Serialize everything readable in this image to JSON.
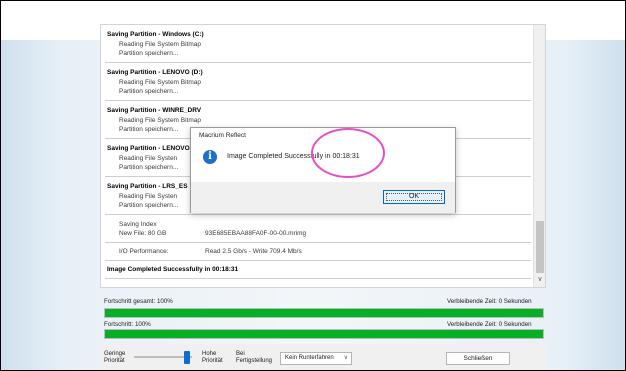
{
  "log": {
    "entries": [
      {
        "title": "Saving Partition - Windows (C:)",
        "lines": [
          "Reading File System Bitmap",
          "Partition speichern..."
        ]
      },
      {
        "title": "Saving Partition - LENOVO (D:)",
        "lines": [
          "Reading File System Bitmap",
          "Partition speichern..."
        ]
      },
      {
        "title": "Saving Partition - WINRE_DRV",
        "lines": [
          "Reading File System Bitmap",
          "Partition speichern..."
        ]
      },
      {
        "title": "Saving Partition - LENOVO",
        "lines": [
          "Reading File Systen",
          "Partition speichern..."
        ]
      },
      {
        "title": "Saving Partition - LRS_ES",
        "lines": [
          "Reading File Systen",
          "Partition speichern..."
        ]
      }
    ],
    "saving_index": "Saving Index",
    "new_file_label": "New File: 80 GB",
    "new_file_value": "93E685EBAA88FA0F-00-00.mrimg",
    "io_label": "I/O Performance:",
    "io_value": "Read 2.5 Gb/s - Write 709.4 Mb/s",
    "completed": "Image Completed Successfully in 00:18:31"
  },
  "dialog": {
    "title": "Macrium Reflect",
    "message": "Image Completed Successfully in 00:18:31",
    "ok_label": "OK",
    "icon": "info-icon"
  },
  "progress": {
    "total_label": "Fortschritt gesamt:  100%",
    "total_remaining": "Verbleibende Zeit: 0 Sekunden",
    "total_fraction": 1.0,
    "current_label": "Fortschritt:  100%",
    "current_remaining": "Verbleibende Zeit: 0 Sekunden",
    "current_fraction": 1.0
  },
  "footer": {
    "low_priority": [
      "Geringe",
      "Priorität"
    ],
    "high_priority": [
      "Hohe",
      "Priorität"
    ],
    "on_completion": [
      "Bei",
      "Fertigstellung"
    ],
    "shutdown_select": "Kein Runterfahren",
    "close_label": "Schließen"
  },
  "colors": {
    "progress_green": "#06b025",
    "highlight_magenta": "#e64fc6",
    "info_blue": "#1e6fc9"
  }
}
